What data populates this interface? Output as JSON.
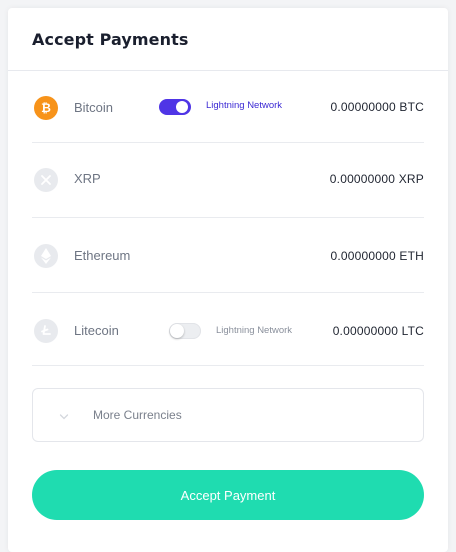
{
  "header": {
    "title": "Accept Payments"
  },
  "currencies": [
    {
      "name": "Bitcoin",
      "amount": "0.00000000 BTC",
      "icon": "bitcoin-icon",
      "color": "#f7931a",
      "lightning": {
        "label": "Lightning Network",
        "enabled": true
      }
    },
    {
      "name": "XRP",
      "amount": "0.00000000 XRP",
      "icon": "xrp-icon",
      "color": "#e6e8ec"
    },
    {
      "name": "Ethereum",
      "amount": "0.00000000 ETH",
      "icon": "ethereum-icon",
      "color": "#e6e8ec"
    },
    {
      "name": "Litecoin",
      "amount": "0.00000000 LTC",
      "icon": "litecoin-icon",
      "color": "#e6e8ec",
      "lightning": {
        "label": "Lightning Network",
        "enabled": false
      }
    }
  ],
  "more": {
    "label": "More Currencies",
    "icon": "chevron-down-icon"
  },
  "accept_button": {
    "label": "Accept Payment",
    "color": "#1fdcb0"
  },
  "colors": {
    "toggle_on": "#4f35e6",
    "lightning_on_text": "#3c2ad4"
  }
}
